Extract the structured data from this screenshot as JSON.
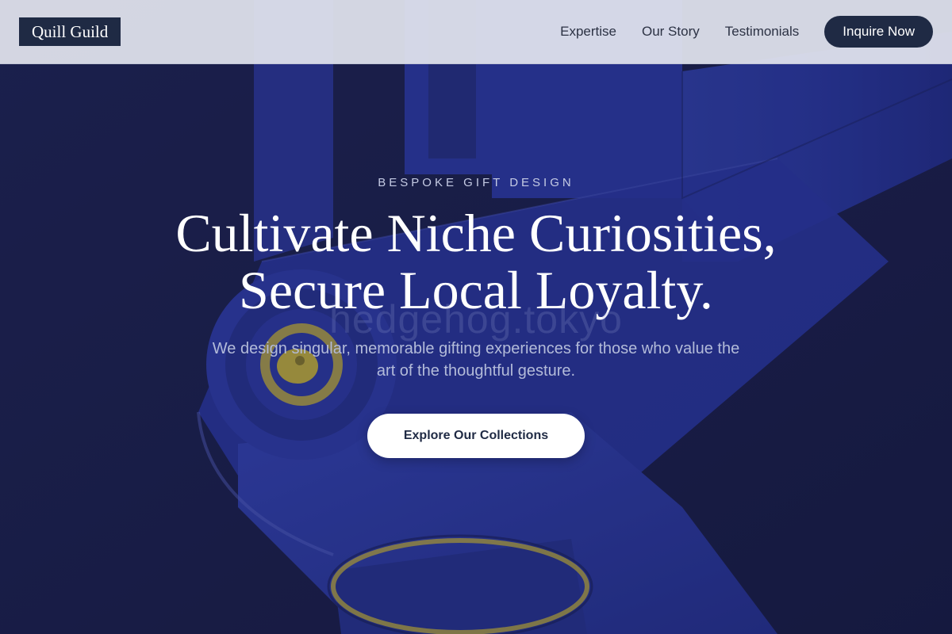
{
  "header": {
    "logo_text": "Quill Guild",
    "nav": [
      {
        "label": "Expertise"
      },
      {
        "label": "Our Story"
      },
      {
        "label": "Testimonials"
      }
    ],
    "cta_label": "Inquire Now"
  },
  "hero": {
    "eyebrow": "BESPOKE GIFT DESIGN",
    "headline_line1": "Cultivate Niche Curiosities,",
    "headline_line2": "Secure Local Loyalty.",
    "watermark": "hedgehog.tokyo",
    "subtext": "We design singular, memorable gifting experiences for those who value the art of the thoughtful gesture.",
    "cta_label": "Explore Our Collections"
  },
  "colors": {
    "background_navy": "#1b1f4a",
    "object_blue": "#2e3aa8",
    "accent_gold": "#c8b43a",
    "header_bg": "#e2e4ee",
    "button_dark": "#1f2a44",
    "button_light": "#ffffff"
  }
}
